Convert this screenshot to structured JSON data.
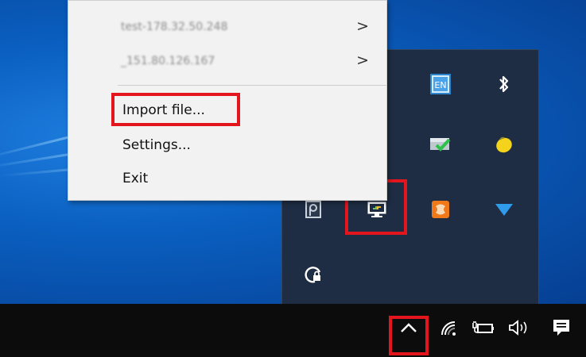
{
  "context_menu": {
    "items": [
      {
        "label": "test-178.32.50.248",
        "has_submenu": true,
        "blurred": true
      },
      {
        "label": "_151.80.126.167",
        "has_submenu": true,
        "blurred": true
      },
      {
        "label": "Import file...",
        "highlighted": true
      },
      {
        "label": "Settings..."
      },
      {
        "label": "Exit"
      }
    ],
    "submenu_glyph": ">"
  },
  "tray_overflow": {
    "icons": [
      "keyboard-layout-icon",
      "bluetooth-icon",
      "security-check-icon",
      "lemon-icon",
      "p-app-icon",
      "network-monitor-icon",
      "app-orange-icon",
      "blue-triangle-icon",
      "locked-circle-icon"
    ],
    "highlighted_icon": "network-monitor-icon"
  },
  "taskbar": {
    "icons": [
      "show-hidden-icons-chevron",
      "wifi-icon",
      "battery-icon",
      "volume-icon",
      "action-center-icon"
    ],
    "highlighted_icon": "show-hidden-icons-chevron"
  },
  "colors": {
    "highlight": "#e3151d",
    "menu_bg": "#f2f2f2",
    "tray_bg": "#1e2d44",
    "taskbar_bg": "#0c0c0c"
  }
}
